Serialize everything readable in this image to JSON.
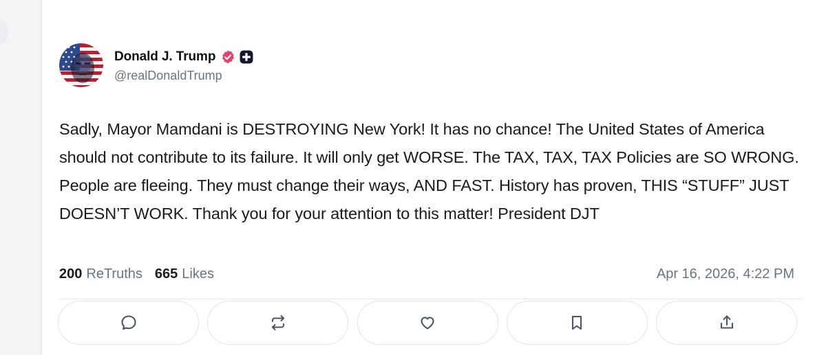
{
  "author": {
    "display_name": "Donald J. Trump",
    "handle": "@realDonaldTrump",
    "verified_badge_color": "#e0446d"
  },
  "post": {
    "text": "Sadly, Mayor Mamdani is DESTROYING New York! It has no chance! The United States of America should not contribute to its failure. It will only get WORSE. The TAX, TAX, TAX Policies are SO WRONG. People are fleeing. They must change their ways, AND FAST. History has proven, THIS “STUFF” JUST DOESN’T WORK. Thank you for your attention to this matter! President DJT"
  },
  "stats": {
    "retruths_count": "200",
    "retruths_label": "ReTruths",
    "likes_count": "665",
    "likes_label": "Likes",
    "timestamp": "Apr 16, 2026, 4:22 PM"
  },
  "actions": [
    {
      "name": "reply",
      "icon": "speech-bubble-icon"
    },
    {
      "name": "retruth",
      "icon": "repost-icon"
    },
    {
      "name": "like",
      "icon": "heart-icon"
    },
    {
      "name": "bookmark",
      "icon": "bookmark-icon"
    },
    {
      "name": "share",
      "icon": "share-icon"
    }
  ],
  "colors": {
    "icon_stroke": "#4b5563",
    "muted_text": "#6b7280",
    "border": "#e2e4e8"
  }
}
